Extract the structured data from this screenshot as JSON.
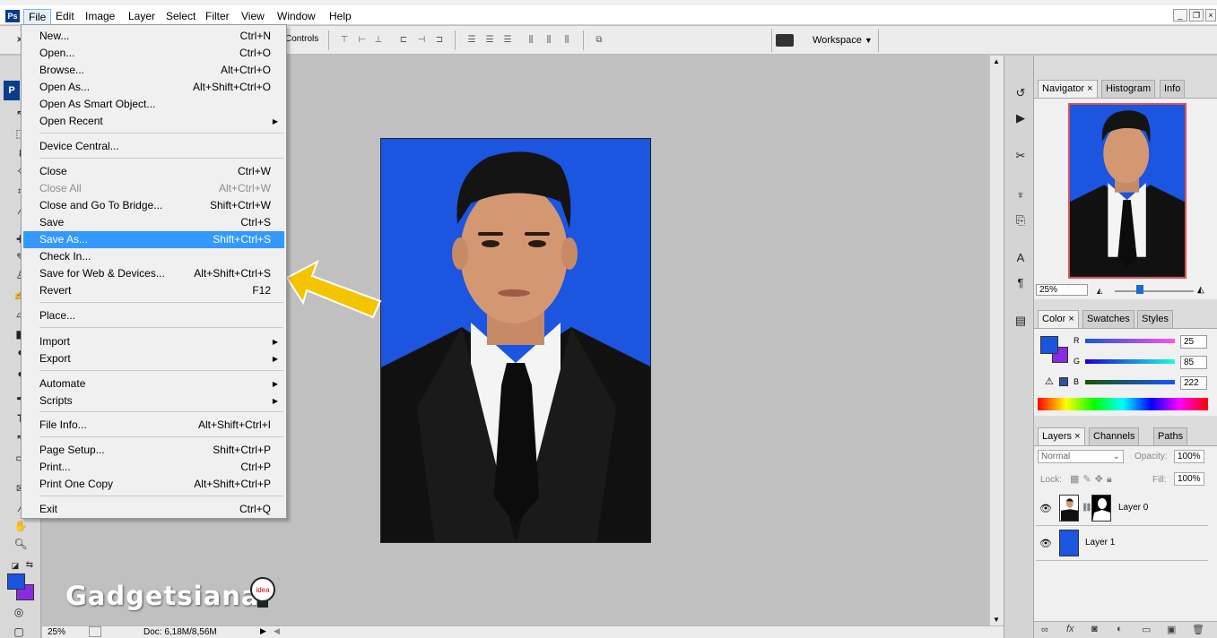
{
  "menubar": {
    "items": [
      "File",
      "Edit",
      "Image",
      "Layer",
      "Select",
      "Filter",
      "View",
      "Window",
      "Help"
    ]
  },
  "options_bar": {
    "controls_label": "Controls",
    "workspace_label": "Workspace"
  },
  "file_menu": {
    "items": [
      {
        "label": "New...",
        "shortcut": "Ctrl+N"
      },
      {
        "label": "Open...",
        "shortcut": "Ctrl+O"
      },
      {
        "label": "Browse...",
        "shortcut": "Alt+Ctrl+O"
      },
      {
        "label": "Open As...",
        "shortcut": "Alt+Shift+Ctrl+O"
      },
      {
        "label": "Open As Smart Object...",
        "shortcut": ""
      },
      {
        "label": "Open Recent",
        "shortcut": ""
      },
      {
        "label": "Device Central...",
        "shortcut": ""
      },
      {
        "label": "Close",
        "shortcut": "Ctrl+W"
      },
      {
        "label": "Close All",
        "shortcut": "Alt+Ctrl+W"
      },
      {
        "label": "Close and Go To Bridge...",
        "shortcut": "Shift+Ctrl+W"
      },
      {
        "label": "Save",
        "shortcut": "Ctrl+S"
      },
      {
        "label": "Save As...",
        "shortcut": "Shift+Ctrl+S"
      },
      {
        "label": "Check In...",
        "shortcut": ""
      },
      {
        "label": "Save for Web & Devices...",
        "shortcut": "Alt+Shift+Ctrl+S"
      },
      {
        "label": "Revert",
        "shortcut": "F12"
      },
      {
        "label": "Place...",
        "shortcut": ""
      },
      {
        "label": "Import",
        "shortcut": ""
      },
      {
        "label": "Export",
        "shortcut": ""
      },
      {
        "label": "Automate",
        "shortcut": ""
      },
      {
        "label": "Scripts",
        "shortcut": ""
      },
      {
        "label": "File Info...",
        "shortcut": "Alt+Shift+Ctrl+I"
      },
      {
        "label": "Page Setup...",
        "shortcut": "Shift+Ctrl+P"
      },
      {
        "label": "Print...",
        "shortcut": "Ctrl+P"
      },
      {
        "label": "Print One Copy",
        "shortcut": "Alt+Shift+Ctrl+P"
      },
      {
        "label": "Exit",
        "shortcut": "Ctrl+Q"
      }
    ],
    "highlighted": "Save As...",
    "disabled": [
      "Close All"
    ]
  },
  "navigator_panel": {
    "tabs": [
      "Navigator",
      "Histogram",
      "Info"
    ],
    "zoom": "25%"
  },
  "color_panel": {
    "tabs": [
      "Color",
      "Swatches",
      "Styles"
    ],
    "r_label": "R",
    "g_label": "G",
    "b_label": "B",
    "r": "25",
    "g": "85",
    "b": "222",
    "foreground_color": "#1955de",
    "background_color": "#8a2be2"
  },
  "layers_panel": {
    "tabs": [
      "Layers",
      "Channels",
      "Paths"
    ],
    "blend_mode": "Normal",
    "opacity_label": "Opacity:",
    "opacity": "100%",
    "lock_label": "Lock:",
    "fill_label": "Fill:",
    "fill": "100%",
    "layers": [
      {
        "name": "Layer 0"
      },
      {
        "name": "Layer 1"
      }
    ]
  },
  "status_bar": {
    "zoom": "25%",
    "doc_info": "Doc: 6,18M/8,56M"
  },
  "watermark": "Gadgetsiana",
  "colors": {
    "photo_background": "#1b55e0",
    "arrow": "#f5c400",
    "menu_highlight": "#3399ff"
  }
}
